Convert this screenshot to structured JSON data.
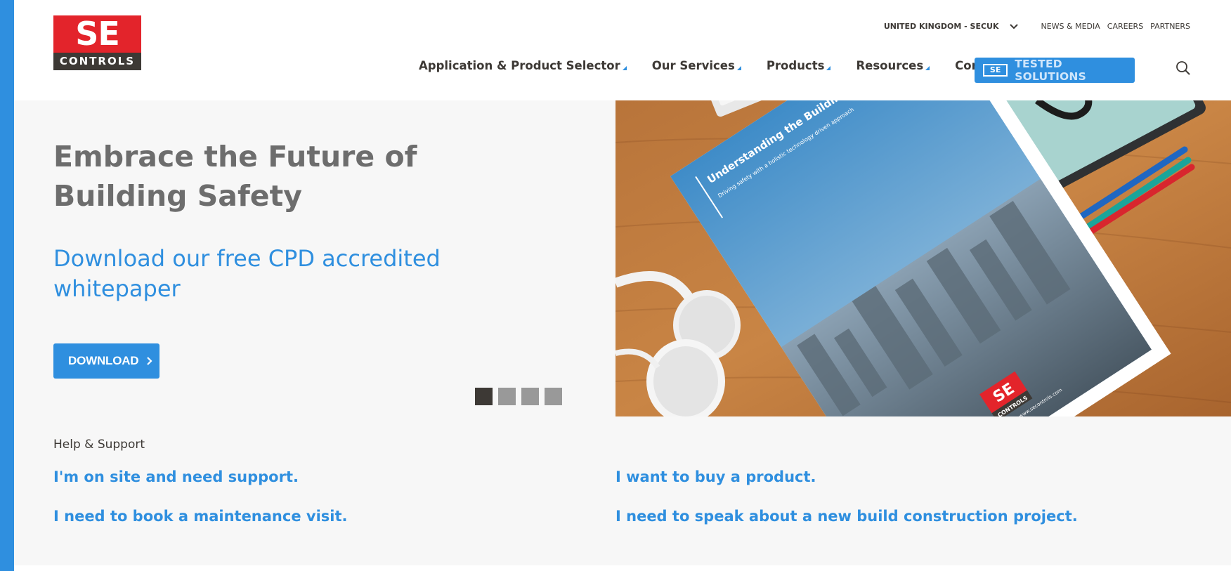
{
  "brand": {
    "logo_top": "SE",
    "logo_bottom": "CONTROLS",
    "accent_color": "#2f8fdf",
    "logo_red": "#e3242b",
    "dark_color": "#3d3935"
  },
  "util_nav": {
    "region": "UNITED KINGDOM - SECUK",
    "region_icon": "chevron-down-icon",
    "links": [
      "NEWS & MEDIA",
      "CAREERS",
      "PARTNERS"
    ]
  },
  "main_nav": {
    "items": [
      {
        "label": "Application & Product Selector",
        "has_menu": true
      },
      {
        "label": "Our Services",
        "has_menu": true
      },
      {
        "label": "Products",
        "has_menu": true
      },
      {
        "label": "Resources",
        "has_menu": true
      },
      {
        "label": "Contact",
        "has_menu": false
      }
    ],
    "tested_button": {
      "mark": "SE",
      "label": "TESTED SOLUTIONS"
    },
    "search_icon": "search-icon"
  },
  "hero": {
    "title": "Embrace the Future of Building Safety",
    "subtitle": "Download our free CPD accredited whitepaper",
    "button_label": "DOWNLOAD",
    "slides": 4,
    "active_slide": 1,
    "image": {
      "brochure_title": "Understanding the Building Safety Act",
      "brochure_subtitle": "Driving safety with a holistic technology driven approach",
      "brochure_url": "www.secontrols.com",
      "logo_top": "SE",
      "logo_bottom": "CONTROLS"
    }
  },
  "help": {
    "heading": "Help & Support",
    "links": [
      "I'm on site and need support.",
      "I want to buy a product.",
      "I need to book a maintenance visit.",
      "I need to speak about a new build construction project."
    ]
  }
}
